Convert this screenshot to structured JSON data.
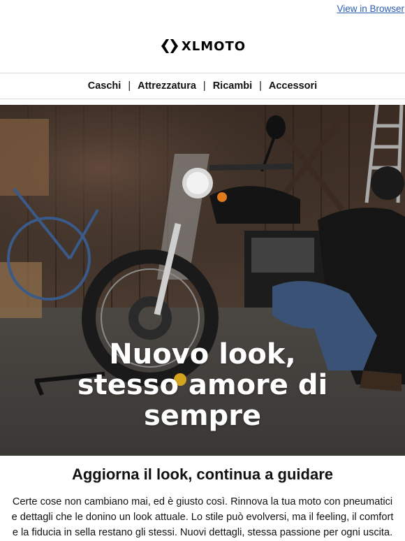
{
  "header": {
    "view_in_browser": "View in Browser",
    "brand": "XLMOTO"
  },
  "nav": {
    "items": [
      "Caschi",
      "Attrezzatura",
      "Ricambi",
      "Accessori"
    ]
  },
  "hero": {
    "title_lines": [
      "Nuovo look,",
      "stesso amore di",
      "sempre"
    ],
    "image_subject": "motorcycle-in-garage-photo"
  },
  "content": {
    "title": "Aggiorna il look, continua a guidare",
    "text": "Certe cose non cambiano mai, ed è giusto così. Rinnova la tua moto con pneumatici e dettagli che le donino un look attuale. Lo stile può evolversi, ma il feeling, il comfort e la fiducia in sella restano gli stessi. Nuovi dettagli, stessa passione per ogni uscita."
  },
  "colors": {
    "link": "#2a5db0",
    "text": "#111111",
    "divider": "#d9d9d9",
    "hero_text": "#ffffff"
  }
}
